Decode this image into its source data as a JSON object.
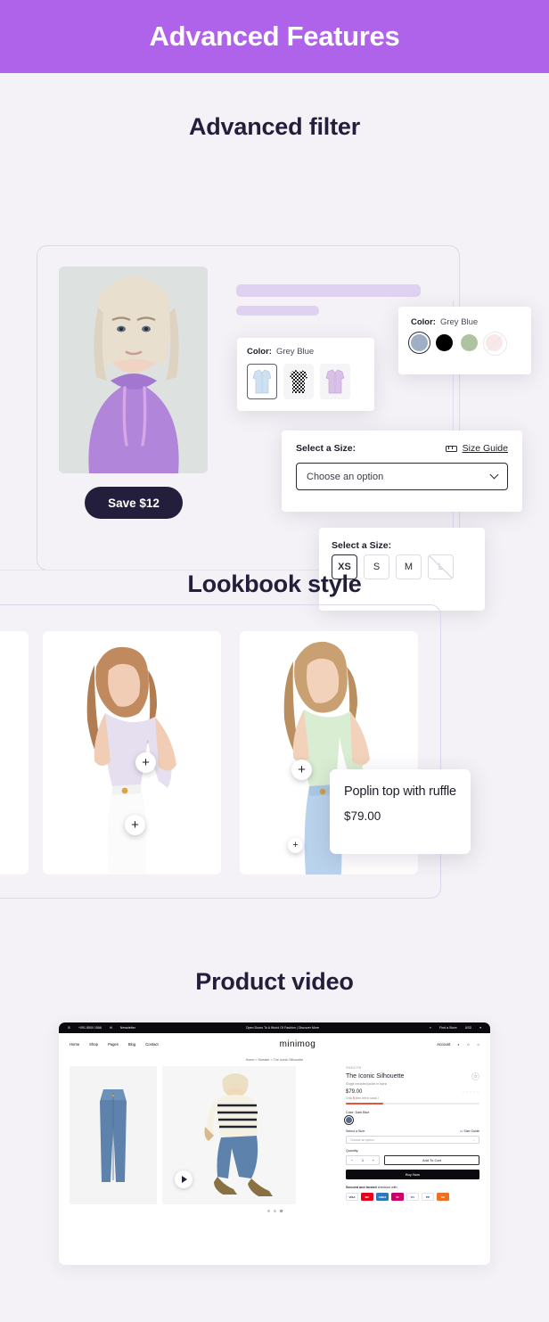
{
  "header": {
    "title": "Advanced Features",
    "bg": "#af62ea"
  },
  "sections": {
    "filter_title": "Advanced filter",
    "lookbook_title": "Lookbook style",
    "video_title": "Product video"
  },
  "filter": {
    "save_label": "Save $12",
    "color_thumbs": {
      "label": "Color:",
      "value": "Grey Blue",
      "options": [
        "Light Blue Shirt",
        "Black Check Shirt",
        "Lilac Shirt"
      ]
    },
    "color_swatches": {
      "label": "Color:",
      "value": "Grey Blue",
      "options": [
        {
          "name": "Grey Blue",
          "hex": "#9fafc4",
          "selected": true,
          "out_of_stock": false
        },
        {
          "name": "Black",
          "hex": "#000000",
          "selected": false,
          "out_of_stock": false
        },
        {
          "name": "Sage",
          "hex": "#aec3a0",
          "selected": false,
          "out_of_stock": false
        },
        {
          "name": "Pink",
          "hex": "#f3d7da",
          "selected": false,
          "out_of_stock": true
        }
      ]
    },
    "size_select": {
      "label": "Select a Size:",
      "guide_label": "Size Guide",
      "placeholder": "Choose an option"
    },
    "size_boxes": {
      "label": "Select a Size:",
      "options": [
        {
          "label": "XS",
          "selected": true,
          "out_of_stock": false
        },
        {
          "label": "S",
          "selected": false,
          "out_of_stock": false
        },
        {
          "label": "M",
          "selected": false,
          "out_of_stock": false
        },
        {
          "label": "L",
          "selected": false,
          "out_of_stock": true
        }
      ]
    }
  },
  "lookbook": {
    "popup": {
      "name": "Poplin top with ruffle",
      "price": "$79.00"
    },
    "hotspot_glyph": "+"
  },
  "video": {
    "browser": {
      "topbar": {
        "phone": "+091 8500 1566",
        "newsletter": "Newsletter",
        "promo": "Open Doors To A World Of Fashion  |  Discover More",
        "store": "Find a Store",
        "currency": "USD"
      },
      "nav": {
        "menu": [
          "Home",
          "Shop",
          "Pages",
          "Blog",
          "Contact"
        ],
        "logo": "minimog",
        "account": "Account",
        "cart_count": "0"
      },
      "breadcrumb": "Home   >   Sweater   >   The Iconic Silhouette",
      "product": {
        "vendor": "SWEATER",
        "title": "The Iconic Silhouette",
        "subtitle": "Single breasted jacket in fabric",
        "price": "$79.00",
        "stars": "☆☆☆☆☆",
        "stock_prefix": "Only ",
        "stock_count": "5",
        "stock_suffix": " item left in stock !",
        "color_label": "Color:",
        "color_value": "Dark Blue",
        "size_label": "Select a Size:",
        "size_guide": "Size Guide",
        "size_placeholder": "Choose an option",
        "quantity_label": "Quantity:",
        "qty_minus": "−",
        "qty_value": "1",
        "qty_plus": "+",
        "add_to_cart": "Add To Cart",
        "buy_now": "Buy Now",
        "secure_bold": "Secured and trusted",
        "secure_rest": " checkout with:",
        "payments": [
          {
            "name": "visa",
            "label": "VISA",
            "bg": "#ffffff",
            "fg": "#1a1f71"
          },
          {
            "name": "mastercard",
            "label": "MC",
            "bg": "#eb001b",
            "fg": "#ffffff"
          },
          {
            "name": "amex",
            "label": "AMEX",
            "bg": "#2e77bc",
            "fg": "#ffffff"
          },
          {
            "name": "ideal",
            "label": "iD",
            "bg": "#cc0066",
            "fg": "#ffffff"
          },
          {
            "name": "maestro",
            "label": "MS",
            "bg": "#ffffff",
            "fg": "#6c6bbd"
          },
          {
            "name": "paypal",
            "label": "PP",
            "bg": "#ffffff",
            "fg": "#003087"
          },
          {
            "name": "discover",
            "label": "DC",
            "bg": "#f26e21",
            "fg": "#ffffff"
          }
        ]
      },
      "gallery_dots": 3
    }
  }
}
